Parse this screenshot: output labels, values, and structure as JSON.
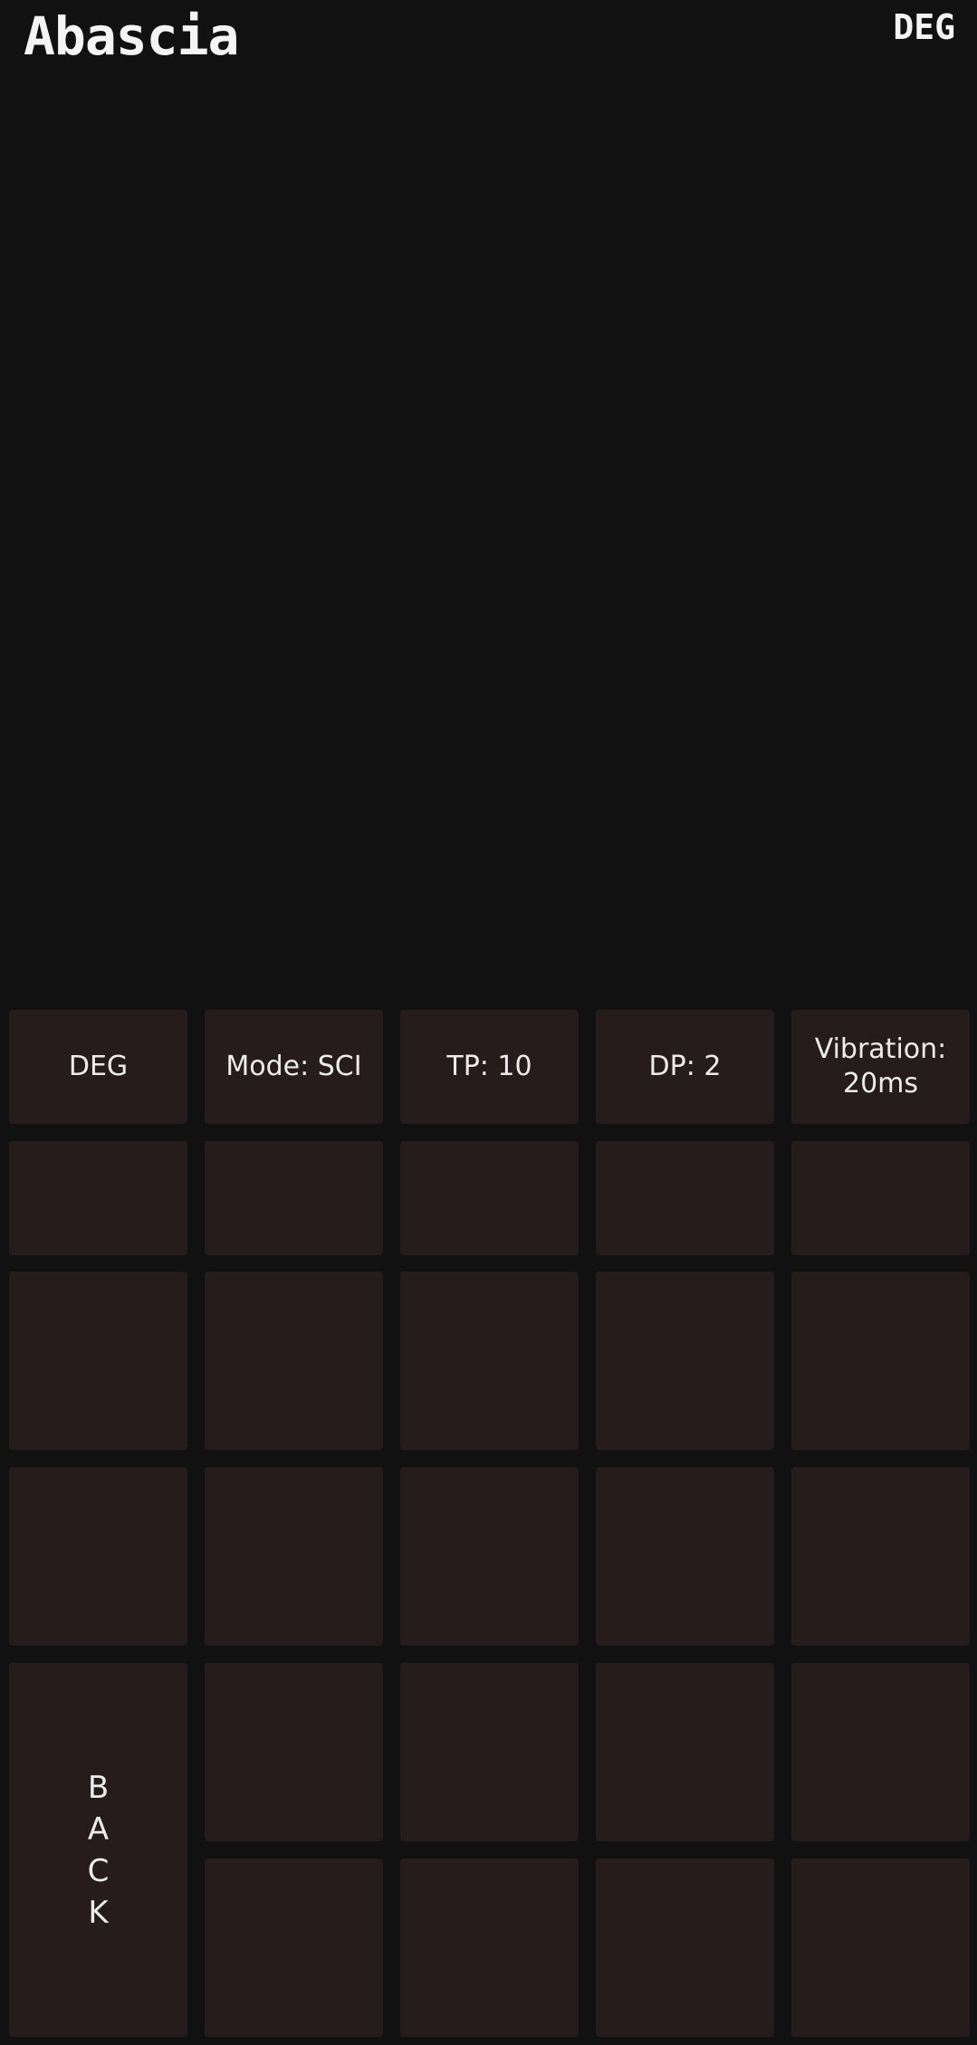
{
  "header": {
    "title": "Abascia",
    "angle_mode": "DEG"
  },
  "settings_row": {
    "angle_button": "DEG",
    "mode_button": "Mode: SCI",
    "tp_button": "TP: 10",
    "dp_button": "DP: 2",
    "vibration_line1": "Vibration:",
    "vibration_line2": "20ms"
  },
  "back_key": {
    "letters": [
      "B",
      "A",
      "C",
      "K"
    ]
  }
}
